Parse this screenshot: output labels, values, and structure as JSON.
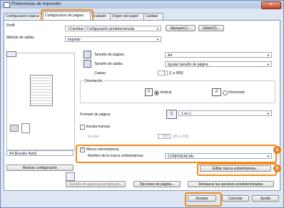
{
  "window": {
    "title": "Preferencias de impresión",
    "close": "✕"
  },
  "tabs": [
    "Configuración básica",
    "Configuración de página",
    "Acabado",
    "Origen del papel",
    "Calidad"
  ],
  "profile": {
    "label": "Perfil:",
    "value": "<Cambiar> Configuración predeterminada",
    "add": "Agregar(1)...",
    "edit": "Editar(2)..."
  },
  "output": {
    "label": "Método de salida:",
    "value": "Imprimir"
  },
  "preview": {
    "scale": "A4 [Escala: Auto]",
    "show_settings": "Mostrar configuración"
  },
  "page": {
    "size_label": "Tamaño de página:",
    "size_value": "A4",
    "output_label": "Tamaño de salida:",
    "output_value": "Igualar tamaño de página",
    "copies_label": "Copias:",
    "copies_value": "1",
    "copies_range": "[1 a 999]",
    "orientation_label": "Orientación",
    "vertical": "Vertical",
    "horizontal": "Horizontal",
    "layout_label": "Formato de página:",
    "layout_value": "1 en 1",
    "manual_scale": "Escala manual",
    "scale_label": "Escala:",
    "scale_value": "100",
    "scale_range": "[25 a 200]"
  },
  "watermark": {
    "check": "Marca sobreimpresa",
    "name_label": "Nombre de la marca sobreimpresa:",
    "name_value": "CONFIDENCIAL",
    "edit": "Editar marca sobreimpresa..."
  },
  "bottom": {
    "custom": "Tamaño de papel personalizado...",
    "page_options": "Opciones de página...",
    "restore": "Restaurar las opciones predeterminadas"
  },
  "footer": {
    "ok": "Aceptar",
    "cancel": "Cancelar",
    "help": "Ayuda"
  },
  "badges": {
    "a": "a",
    "b": "b"
  },
  "colors": {
    "highlight": "#f08a1c"
  }
}
